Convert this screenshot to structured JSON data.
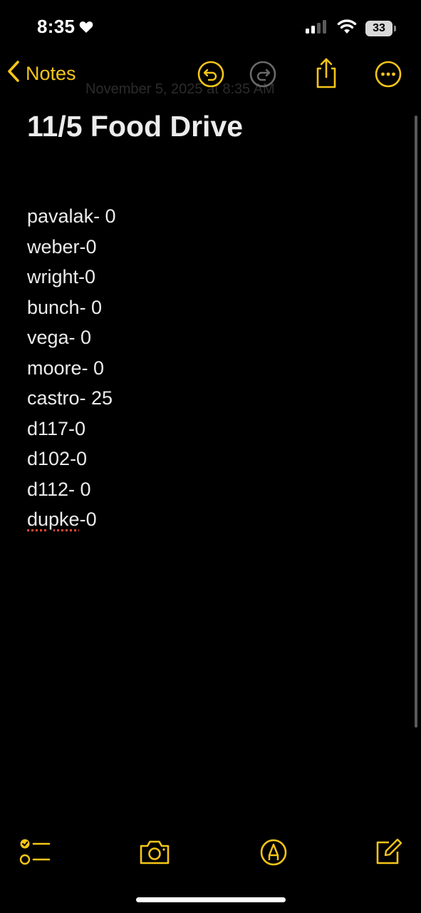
{
  "status_bar": {
    "time": "8:35",
    "battery_level": "33",
    "icons": [
      "heart-icon",
      "cellular-signal-icon",
      "wifi-icon",
      "battery-icon"
    ]
  },
  "nav": {
    "back_label": "Notes",
    "faded_title": "November 5, 2025 at 8:35 AM",
    "icons": [
      "undo-icon",
      "redo-icon",
      "share-icon",
      "more-icon"
    ]
  },
  "note": {
    "title": "11/5 Food Drive",
    "lines": [
      "pavalak- 0",
      "weber-0",
      "wright-0",
      "bunch- 0",
      "vega- 0",
      "moore- 0",
      "castro- 25",
      "d117-0",
      "d102-0",
      "d112- 0",
      "dupke-0"
    ],
    "last_line_word": "dupke",
    "last_line_rest": "-0"
  },
  "toolbar": {
    "icons": [
      "checklist-icon",
      "camera-icon",
      "markup-pen-icon",
      "compose-icon"
    ]
  },
  "colors": {
    "accent": "#f5c518",
    "background": "#000000",
    "text": "#ececec",
    "spelling_underline": "#e0483c"
  }
}
